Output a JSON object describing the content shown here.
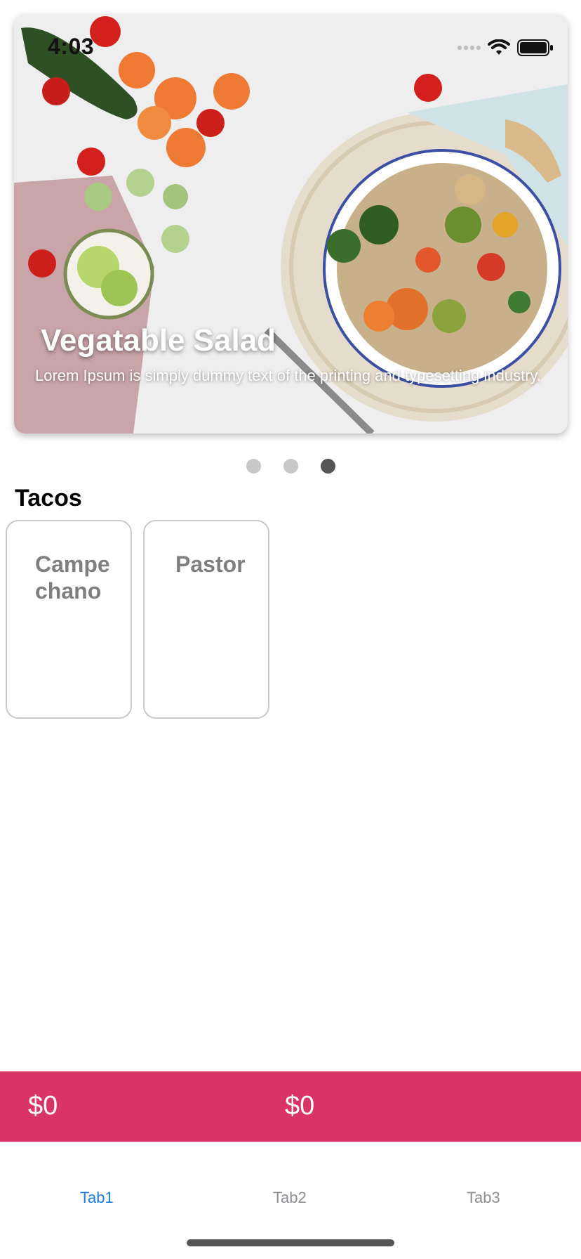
{
  "status_bar": {
    "time": "4:03"
  },
  "hero": {
    "title": "Vegatable Salad",
    "description": "Lorem Ipsum is simply dummy text of the printing and typesetting industry."
  },
  "pagination": {
    "count": 3,
    "active_index": 2
  },
  "section": {
    "title": "Tacos"
  },
  "taco_cards": [
    {
      "name": "Campechano"
    },
    {
      "name": "Pastor"
    }
  ],
  "price_bar": {
    "left_price": "$0",
    "right_price": "$0",
    "color": "#d93463"
  },
  "tabs": [
    {
      "label": "Tab1",
      "active": true
    },
    {
      "label": "Tab2",
      "active": false
    },
    {
      "label": "Tab3",
      "active": false
    }
  ],
  "colors": {
    "accent": "#1a7ee6",
    "inactive_tab": "#8e8e93"
  }
}
